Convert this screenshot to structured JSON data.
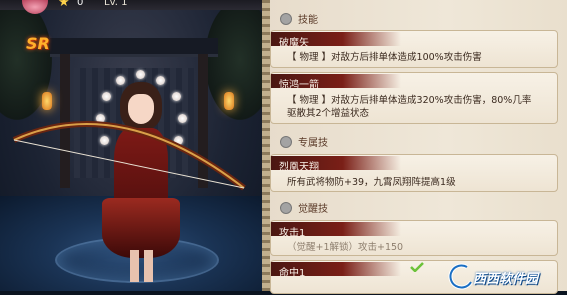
{
  "top_bar": {
    "count": "0",
    "level": "Lv. 1"
  },
  "rarity": "SR",
  "sections": {
    "skills": "技能",
    "exclusive": "专属技",
    "awaken": "觉醒技"
  },
  "skills": [
    {
      "name": "破魔矢",
      "desc": "【 物理 】对敌方后排单体造成100%攻击伤害"
    },
    {
      "name": "惊鸿一箭",
      "desc_line1": "【 物理 】对敌方后排单体造成320%攻击伤害，80%几率",
      "desc_line2": "驱散其2个增益状态"
    }
  ],
  "exclusive": {
    "name": "烈凰天翔",
    "desc": "所有武将物防+39，九霄凤翔阵提高1级"
  },
  "awaken": [
    {
      "name": "攻击1",
      "desc": "（觉醒+1解锁）攻击+150"
    },
    {
      "name": "命中1"
    }
  ],
  "watermark": "西西软件园",
  "colors": {
    "ribbon": "#7a1f17",
    "panel": "#efe7d8",
    "accent_check": "#6cc23a"
  }
}
